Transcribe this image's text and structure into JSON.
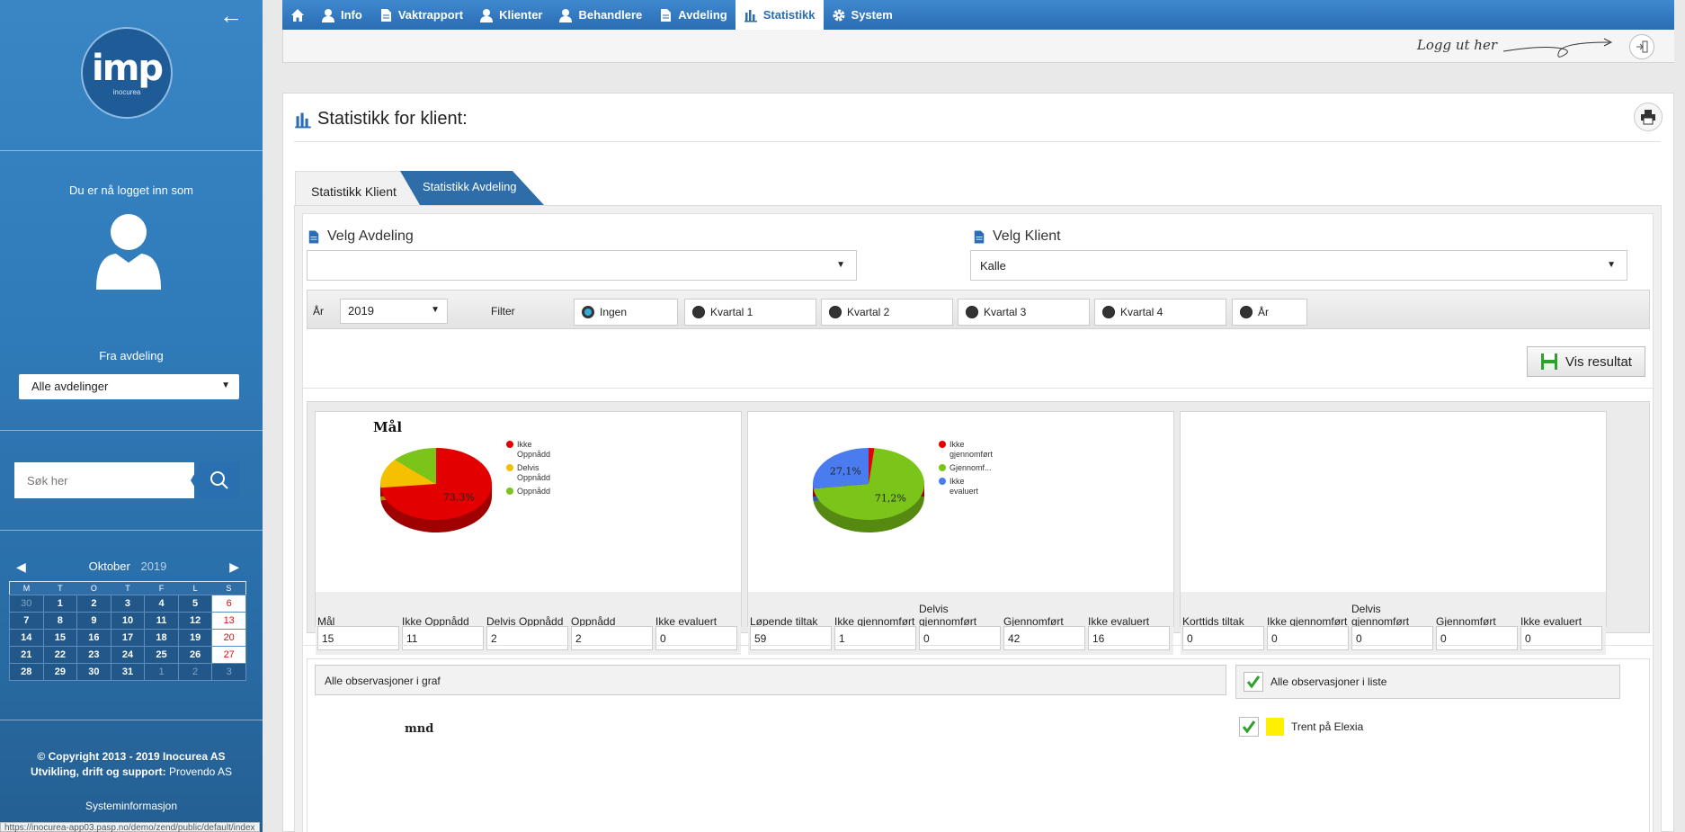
{
  "sidebar": {
    "logo_text": "imp",
    "logo_sub": "inocurea",
    "logged_in_label": "Du er nå logget inn som",
    "from_dept_label": "Fra avdeling",
    "dept_select": "Alle avdelinger",
    "search_placeholder": "Søk her",
    "calendar": {
      "month": "Oktober",
      "year": "2019",
      "weekdays": [
        "M",
        "T",
        "O",
        "T",
        "F",
        "L",
        "S"
      ],
      "weeks": [
        [
          "30",
          "1",
          "2",
          "3",
          "4",
          "5",
          "6"
        ],
        [
          "7",
          "8",
          "9",
          "10",
          "11",
          "12",
          "13"
        ],
        [
          "14",
          "15",
          "16",
          "17",
          "18",
          "19",
          "20"
        ],
        [
          "21",
          "22",
          "23",
          "24",
          "25",
          "26",
          "27"
        ],
        [
          "28",
          "29",
          "30",
          "31",
          "1",
          "2",
          "3"
        ]
      ]
    },
    "copyright_line1": "© Copyright 2013 - 2019 Inocurea AS",
    "copyright_line2_prefix": "Utvikling, drift og support:",
    "copyright_line2_company": "Provendo AS",
    "sysinfo": "Systeminformasjon",
    "status_url": "https://inocurea-app03.pasp.no/demo/zend/public/default/index"
  },
  "nav": {
    "items": [
      {
        "label": "",
        "icon": "home-icon"
      },
      {
        "label": "Info",
        "icon": "user-icon"
      },
      {
        "label": "Vaktrapport",
        "icon": "document-icon"
      },
      {
        "label": "Klienter",
        "icon": "user-icon"
      },
      {
        "label": "Behandlere",
        "icon": "user-icon"
      },
      {
        "label": "Avdeling",
        "icon": "document-icon"
      },
      {
        "label": "Statistikk",
        "icon": "bar-chart-icon",
        "active": true
      },
      {
        "label": "System",
        "icon": "gear-icon"
      }
    ],
    "logout_text": "Logg ut her"
  },
  "main": {
    "title": "Statistikk for klient:",
    "tabs": {
      "klient": "Statistikk Klient",
      "avdeling": "Statistikk Avdeling"
    },
    "velg_avdeling_label": "Velg Avdeling",
    "velg_avdeling_value": "",
    "velg_klient_label": "Velg Klient",
    "velg_klient_value": "Kalle",
    "year_label": "År",
    "year_value": "2019",
    "filter_label": "Filter",
    "filter_options": [
      {
        "label": "Ingen",
        "selected": true
      },
      {
        "label": "Kvartal 1",
        "selected": false
      },
      {
        "label": "Kvartal 2",
        "selected": false
      },
      {
        "label": "Kvartal 3",
        "selected": false
      },
      {
        "label": "Kvartal 4",
        "selected": false
      },
      {
        "label": "År",
        "selected": false
      }
    ],
    "vis_resultat": "Vis resultat",
    "obs_graph": "Alle observasjoner i graf",
    "obs_list": "Alle observasjoner i liste",
    "mnd_label": "mnd",
    "trent_label": "Trent på Elexia"
  },
  "stats": [
    {
      "columns": [
        "Mål",
        "Ikke Oppnådd",
        "Delvis Oppnådd",
        "Oppnådd",
        "Ikke evaluert"
      ],
      "values": [
        "15",
        "11",
        "2",
        "2",
        "0"
      ]
    },
    {
      "columns": [
        "Løpende tiltak",
        "Ikke gjennomført",
        "Delvis gjennomført",
        "Gjennomført",
        "Ikke evaluert"
      ],
      "values": [
        "59",
        "1",
        "0",
        "42",
        "16"
      ]
    },
    {
      "columns": [
        "Korttids tiltak",
        "Ikke gjennomført",
        "Delvis gjennomført",
        "Gjennomført",
        "Ikke evaluert"
      ],
      "values": [
        "0",
        "0",
        "0",
        "0",
        "0"
      ]
    }
  ],
  "chart_data": [
    {
      "type": "pie",
      "title": "Mål",
      "categories": [
        "Ikke Oppnådd",
        "Delvis Oppnådd",
        "Oppnådd"
      ],
      "values": [
        73.3,
        13.35,
        13.35
      ],
      "labels": [
        "73,3%",
        "",
        ""
      ],
      "colors": [
        "#e30000",
        "#f5c000",
        "#7bc41a"
      ],
      "legend": "right"
    },
    {
      "type": "pie",
      "title": "",
      "categories": [
        "Ikke gjennomført",
        "Gjennomf...",
        "Ikke evaluert"
      ],
      "values": [
        1.7,
        71.2,
        27.1
      ],
      "labels": [
        "",
        "71,2%",
        "27,1%"
      ],
      "colors": [
        "#e30000",
        "#7bc41a",
        "#4a7cf0"
      ],
      "legend": "right"
    }
  ]
}
